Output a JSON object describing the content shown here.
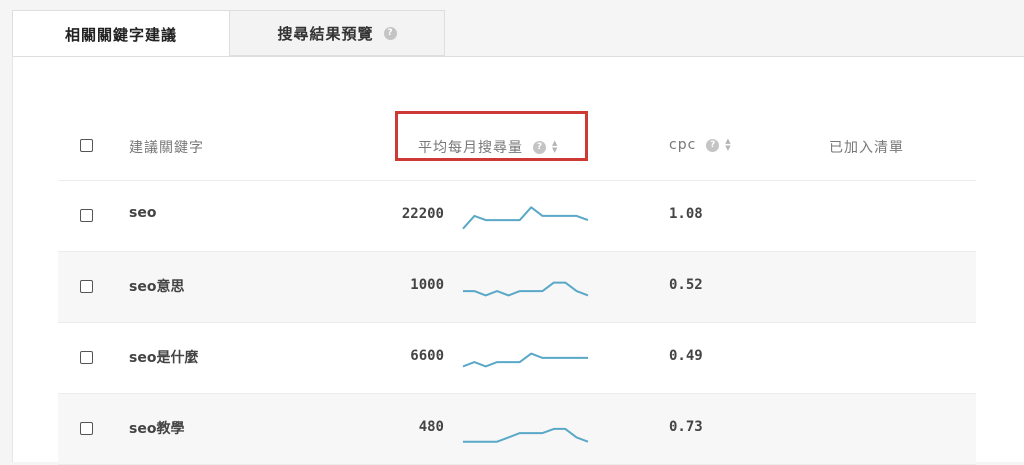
{
  "tabs": {
    "related_keywords": "相關關鍵字建議",
    "search_preview": "搜尋結果預覽",
    "help_glyph": "?"
  },
  "table": {
    "headers": {
      "keyword": "建議關鍵字",
      "avg_monthly_volume": "平均每月搜尋量",
      "cpc": "cpc",
      "added_to_list": "已加入清單"
    },
    "sort_up_glyph": "▲",
    "sort_down_glyph": "▼",
    "rows": [
      {
        "keyword": "seo",
        "volume": "22200",
        "cpc": "1.08",
        "trend": [
          4,
          7,
          6,
          6,
          6,
          6,
          9,
          7,
          7,
          7,
          7,
          6
        ]
      },
      {
        "keyword": "seo意思",
        "volume": "1000",
        "cpc": "0.52",
        "trend": [
          6,
          6,
          5,
          6,
          5,
          6,
          6,
          6,
          8,
          8,
          6,
          5
        ]
      },
      {
        "keyword": "seo是什麼",
        "volume": "6600",
        "cpc": "0.49",
        "trend": [
          5,
          6,
          5,
          6,
          6,
          6,
          8,
          7,
          7,
          7,
          7,
          7
        ]
      },
      {
        "keyword": "seo教學",
        "volume": "480",
        "cpc": "0.73",
        "trend": [
          4,
          4,
          4,
          4,
          5,
          6,
          6,
          6,
          7,
          7,
          5,
          4
        ]
      }
    ]
  },
  "colors": {
    "sparkline": "#5aa8c7",
    "highlight": "#cc3a33"
  }
}
